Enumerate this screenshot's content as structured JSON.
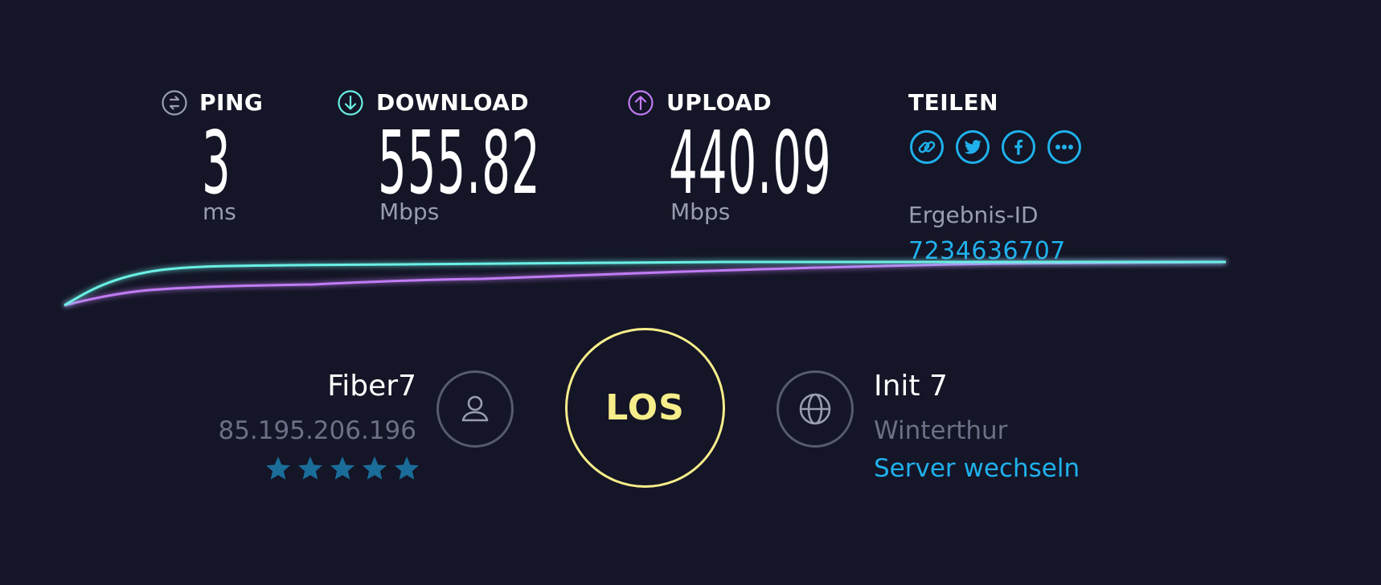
{
  "metrics": {
    "ping": {
      "label": "PING",
      "value": "3",
      "unit": "ms",
      "icon": "ping-icon"
    },
    "download": {
      "label": "DOWNLOAD",
      "value": "555.82",
      "unit": "Mbps",
      "icon": "download-arrow-icon"
    },
    "upload": {
      "label": "UPLOAD",
      "value": "440.09",
      "unit": "Mbps",
      "icon": "upload-arrow-icon"
    }
  },
  "share": {
    "label": "TEILEN",
    "buttons": [
      "link-icon",
      "twitter-icon",
      "facebook-icon",
      "more-icon"
    ],
    "result_label": "Ergebnis-ID",
    "result_id": "7234636707"
  },
  "isp": {
    "name": "Fiber7",
    "ip": "85.195.206.196",
    "rating": 5,
    "icon": "user-icon"
  },
  "go_button": {
    "label": "LOS"
  },
  "server": {
    "name": "Init 7",
    "location": "Winterthur",
    "change_label": "Server wechseln",
    "icon": "globe-icon"
  },
  "colors": {
    "background": "#141526",
    "download": "#6af0e4",
    "upload": "#c17cf4",
    "accent": "#1fb1ec",
    "go": "#f7ee8b",
    "star": "#1b6d99",
    "muted": "#6d6f86"
  }
}
